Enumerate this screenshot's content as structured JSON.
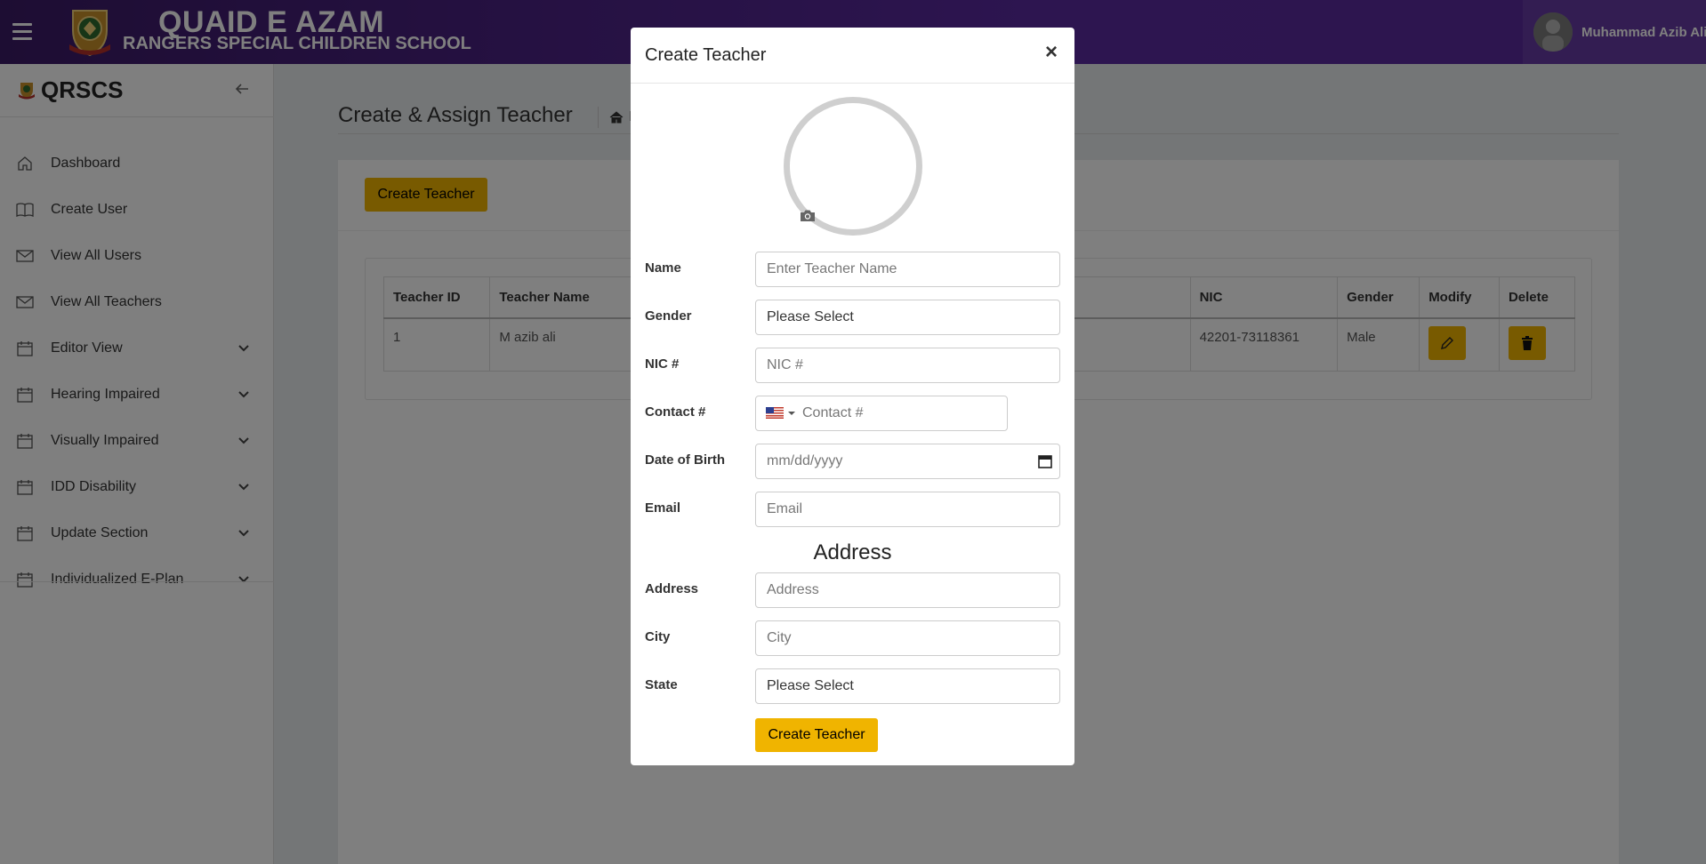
{
  "header": {
    "school_line1": "QUAID E AZAM",
    "school_line2": "RANGERS SPECIAL CHILDREN SCHOOL",
    "user_name": "Muhammad Azib Ali"
  },
  "sidebar": {
    "brand": "QRSCS",
    "items": [
      {
        "label": "Dashboard",
        "icon": "home-icon",
        "expandable": false
      },
      {
        "label": "Create User",
        "icon": "book-icon",
        "expandable": false
      },
      {
        "label": "View All Users",
        "icon": "envelope-icon",
        "expandable": false
      },
      {
        "label": "View All Teachers",
        "icon": "envelope-icon",
        "expandable": false
      },
      {
        "label": "Editor View",
        "icon": "calendar-icon",
        "expandable": true
      },
      {
        "label": "Hearing Impaired",
        "icon": "calendar-icon",
        "expandable": true
      },
      {
        "label": "Visually Impaired",
        "icon": "calendar-icon",
        "expandable": true
      },
      {
        "label": "IDD Disability",
        "icon": "calendar-icon",
        "expandable": true
      },
      {
        "label": "Update Section",
        "icon": "calendar-icon",
        "expandable": true
      },
      {
        "label": "Individualized E-Plan",
        "icon": "calendar-icon",
        "expandable": true
      }
    ]
  },
  "main": {
    "page_title": "Create & Assign Teacher",
    "breadcrumb_text": "Ec",
    "create_button": "Create Teacher",
    "table": {
      "headers": [
        "Teacher ID",
        "Teacher Name",
        "",
        "NIC",
        "Gender",
        "Modify",
        "Delete"
      ],
      "rows": [
        {
          "id": "1",
          "name": "M azib ali",
          "blank": "",
          "nic": "42201-73118361",
          "gender": "Male"
        }
      ]
    }
  },
  "modal": {
    "title": "Create Teacher",
    "close": "×",
    "fields": {
      "name": {
        "label": "Name",
        "placeholder": "Enter Teacher Name"
      },
      "gender": {
        "label": "Gender",
        "value": "Please Select"
      },
      "nic": {
        "label": "NIC #",
        "placeholder": "NIC #"
      },
      "contact": {
        "label": "Contact #",
        "placeholder": "Contact #"
      },
      "dob": {
        "label": "Date of Birth",
        "placeholder": "mm/dd/yyyy"
      },
      "email": {
        "label": "Email",
        "placeholder": "Email"
      },
      "address": {
        "label": "Address",
        "placeholder": "Address"
      },
      "city": {
        "label": "City",
        "placeholder": "City"
      },
      "state": {
        "label": "State",
        "value": "Please Select"
      }
    },
    "address_heading": "Address",
    "submit_button": "Create Teacher"
  },
  "colors": {
    "topbar_start": "#3b1a66",
    "topbar_end": "#5b2b9e",
    "accent_yellow": "#f0b400",
    "overlay": "rgba(0,0,0,0.5)"
  }
}
